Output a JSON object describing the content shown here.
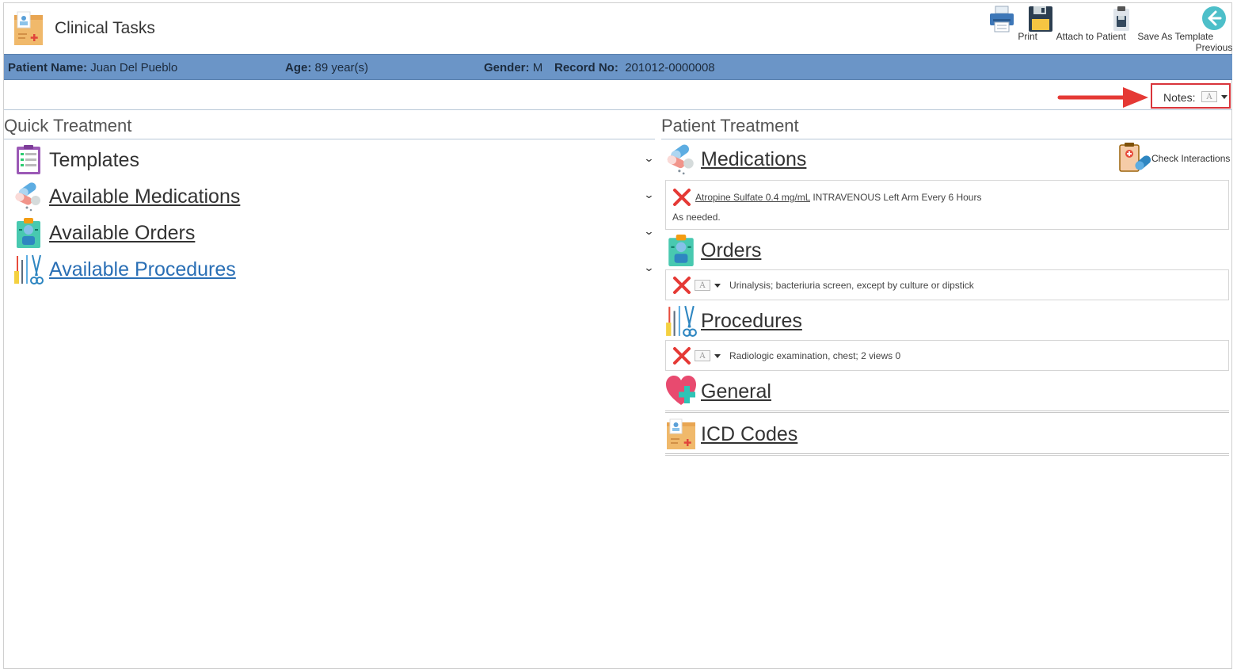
{
  "header": {
    "title": "Clinical Tasks"
  },
  "toolbar": {
    "print": "Print",
    "attach": "Attach to Patient",
    "save_template": "Save As Template",
    "previous": "Previous"
  },
  "patient": {
    "name_label": "Patient Name:",
    "name": "Juan Del Pueblo",
    "age_label": "Age:",
    "age": "89 year(s)",
    "gender_label": "Gender:",
    "gender": "M",
    "record_label": "Record No:",
    "record": "201012-0000008"
  },
  "notes": {
    "label": "Notes:"
  },
  "quick_treatment": {
    "title": "Quick Treatment",
    "items": [
      {
        "label": "Templates"
      },
      {
        "label": "Available Medications"
      },
      {
        "label": "Available Orders"
      },
      {
        "label": "Available Procedures"
      }
    ],
    "chevron": "⌄"
  },
  "patient_treatment": {
    "title": "Patient Treatment",
    "check_interactions": "Check Interactions",
    "medications": {
      "label": "Medications",
      "entry": {
        "drug": "Atropine Sulfate  0.4 mg/mL",
        "details": "INTRAVENOUS Left Arm Every 6 Hours",
        "note": "As needed."
      }
    },
    "orders": {
      "label": "Orders",
      "entry": "Urinalysis; bacteriuria screen, except by culture or dipstick"
    },
    "procedures": {
      "label": "Procedures",
      "entry": "Radiologic examination, chest; 2 views 0"
    },
    "general": {
      "label": "General"
    },
    "icd": {
      "label": "ICD Codes"
    }
  },
  "icons": [
    "clinical-tasks-icon",
    "printer-icon",
    "floppy-disk-icon",
    "clipboard-save-icon",
    "back-arrow-icon",
    "notes-text-icon",
    "templates-icon",
    "pills-icon",
    "orders-icon",
    "procedures-icon",
    "check-interactions-icon",
    "remove-icon",
    "heart-plus-icon",
    "icd-folder-icon"
  ],
  "colors": {
    "patient_bar": "#6b95c7",
    "link_blue": "#2a6fb5",
    "highlight_red": "#d9343a",
    "remove_red": "#e53935"
  }
}
